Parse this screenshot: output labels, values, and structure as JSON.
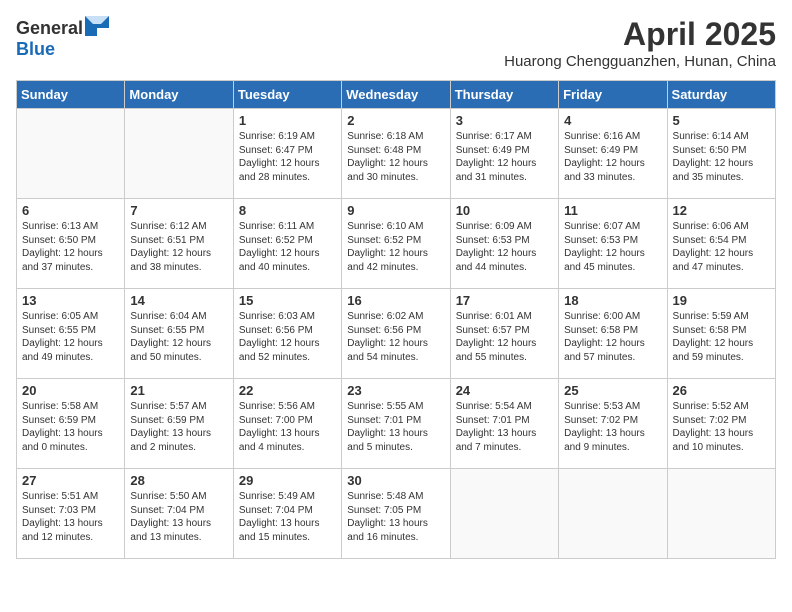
{
  "header": {
    "logo_general": "General",
    "logo_blue": "Blue",
    "month_year": "April 2025",
    "location": "Huarong Chengguanzhen, Hunan, China"
  },
  "columns": [
    "Sunday",
    "Monday",
    "Tuesday",
    "Wednesday",
    "Thursday",
    "Friday",
    "Saturday"
  ],
  "weeks": [
    [
      {
        "day": "",
        "info": ""
      },
      {
        "day": "",
        "info": ""
      },
      {
        "day": "1",
        "info": "Sunrise: 6:19 AM\nSunset: 6:47 PM\nDaylight: 12 hours and 28 minutes."
      },
      {
        "day": "2",
        "info": "Sunrise: 6:18 AM\nSunset: 6:48 PM\nDaylight: 12 hours and 30 minutes."
      },
      {
        "day": "3",
        "info": "Sunrise: 6:17 AM\nSunset: 6:49 PM\nDaylight: 12 hours and 31 minutes."
      },
      {
        "day": "4",
        "info": "Sunrise: 6:16 AM\nSunset: 6:49 PM\nDaylight: 12 hours and 33 minutes."
      },
      {
        "day": "5",
        "info": "Sunrise: 6:14 AM\nSunset: 6:50 PM\nDaylight: 12 hours and 35 minutes."
      }
    ],
    [
      {
        "day": "6",
        "info": "Sunrise: 6:13 AM\nSunset: 6:50 PM\nDaylight: 12 hours and 37 minutes."
      },
      {
        "day": "7",
        "info": "Sunrise: 6:12 AM\nSunset: 6:51 PM\nDaylight: 12 hours and 38 minutes."
      },
      {
        "day": "8",
        "info": "Sunrise: 6:11 AM\nSunset: 6:52 PM\nDaylight: 12 hours and 40 minutes."
      },
      {
        "day": "9",
        "info": "Sunrise: 6:10 AM\nSunset: 6:52 PM\nDaylight: 12 hours and 42 minutes."
      },
      {
        "day": "10",
        "info": "Sunrise: 6:09 AM\nSunset: 6:53 PM\nDaylight: 12 hours and 44 minutes."
      },
      {
        "day": "11",
        "info": "Sunrise: 6:07 AM\nSunset: 6:53 PM\nDaylight: 12 hours and 45 minutes."
      },
      {
        "day": "12",
        "info": "Sunrise: 6:06 AM\nSunset: 6:54 PM\nDaylight: 12 hours and 47 minutes."
      }
    ],
    [
      {
        "day": "13",
        "info": "Sunrise: 6:05 AM\nSunset: 6:55 PM\nDaylight: 12 hours and 49 minutes."
      },
      {
        "day": "14",
        "info": "Sunrise: 6:04 AM\nSunset: 6:55 PM\nDaylight: 12 hours and 50 minutes."
      },
      {
        "day": "15",
        "info": "Sunrise: 6:03 AM\nSunset: 6:56 PM\nDaylight: 12 hours and 52 minutes."
      },
      {
        "day": "16",
        "info": "Sunrise: 6:02 AM\nSunset: 6:56 PM\nDaylight: 12 hours and 54 minutes."
      },
      {
        "day": "17",
        "info": "Sunrise: 6:01 AM\nSunset: 6:57 PM\nDaylight: 12 hours and 55 minutes."
      },
      {
        "day": "18",
        "info": "Sunrise: 6:00 AM\nSunset: 6:58 PM\nDaylight: 12 hours and 57 minutes."
      },
      {
        "day": "19",
        "info": "Sunrise: 5:59 AM\nSunset: 6:58 PM\nDaylight: 12 hours and 59 minutes."
      }
    ],
    [
      {
        "day": "20",
        "info": "Sunrise: 5:58 AM\nSunset: 6:59 PM\nDaylight: 13 hours and 0 minutes."
      },
      {
        "day": "21",
        "info": "Sunrise: 5:57 AM\nSunset: 6:59 PM\nDaylight: 13 hours and 2 minutes."
      },
      {
        "day": "22",
        "info": "Sunrise: 5:56 AM\nSunset: 7:00 PM\nDaylight: 13 hours and 4 minutes."
      },
      {
        "day": "23",
        "info": "Sunrise: 5:55 AM\nSunset: 7:01 PM\nDaylight: 13 hours and 5 minutes."
      },
      {
        "day": "24",
        "info": "Sunrise: 5:54 AM\nSunset: 7:01 PM\nDaylight: 13 hours and 7 minutes."
      },
      {
        "day": "25",
        "info": "Sunrise: 5:53 AM\nSunset: 7:02 PM\nDaylight: 13 hours and 9 minutes."
      },
      {
        "day": "26",
        "info": "Sunrise: 5:52 AM\nSunset: 7:02 PM\nDaylight: 13 hours and 10 minutes."
      }
    ],
    [
      {
        "day": "27",
        "info": "Sunrise: 5:51 AM\nSunset: 7:03 PM\nDaylight: 13 hours and 12 minutes."
      },
      {
        "day": "28",
        "info": "Sunrise: 5:50 AM\nSunset: 7:04 PM\nDaylight: 13 hours and 13 minutes."
      },
      {
        "day": "29",
        "info": "Sunrise: 5:49 AM\nSunset: 7:04 PM\nDaylight: 13 hours and 15 minutes."
      },
      {
        "day": "30",
        "info": "Sunrise: 5:48 AM\nSunset: 7:05 PM\nDaylight: 13 hours and 16 minutes."
      },
      {
        "day": "",
        "info": ""
      },
      {
        "day": "",
        "info": ""
      },
      {
        "day": "",
        "info": ""
      }
    ]
  ]
}
